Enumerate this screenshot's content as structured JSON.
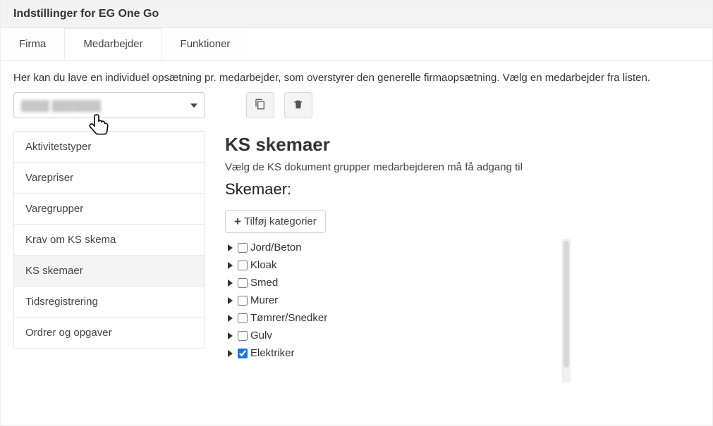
{
  "header": {
    "title": "Indstillinger for EG One Go"
  },
  "tabs": [
    {
      "label": "Firma",
      "active": false
    },
    {
      "label": "Medarbejder",
      "active": true
    },
    {
      "label": "Funktioner",
      "active": false
    }
  ],
  "intro": "Her kan du lave en individuel opsætning pr. medarbejder, som overstyrer den generelle firmaopsætning. Vælg en medarbejder fra listen.",
  "employee_select": {
    "placeholder_blur": "████ ███████"
  },
  "icon_buttons": {
    "copy_title": "Kopier",
    "delete_title": "Slet"
  },
  "sidebar": {
    "items": [
      {
        "label": "Aktivitetstyper",
        "active": false
      },
      {
        "label": "Varepriser",
        "active": false
      },
      {
        "label": "Varegrupper",
        "active": false
      },
      {
        "label": "Krav om KS skema",
        "active": false
      },
      {
        "label": "KS skemaer",
        "active": true
      },
      {
        "label": "Tidsregistrering",
        "active": false
      },
      {
        "label": "Ordrer og opgaver",
        "active": false
      }
    ]
  },
  "main": {
    "heading": "KS skemaer",
    "description": "Vælg de KS dokument grupper medarbejderen må få adgang til",
    "subheading": "Skemaer:",
    "add_button": "Tilføj kategorier",
    "categories": [
      {
        "label": "Jord/Beton",
        "checked": false
      },
      {
        "label": "Kloak",
        "checked": false
      },
      {
        "label": "Smed",
        "checked": false
      },
      {
        "label": "Murer",
        "checked": false
      },
      {
        "label": "Tømrer/Snedker",
        "checked": false
      },
      {
        "label": "Gulv",
        "checked": false
      },
      {
        "label": "Elektriker",
        "checked": true
      }
    ]
  }
}
